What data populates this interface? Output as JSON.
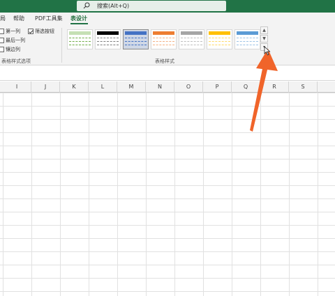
{
  "title_bar": {
    "search_placeholder": "搜索(Alt+Q)",
    "search_icon": "search-icon"
  },
  "tabs": [
    {
      "label": "局"
    },
    {
      "label": "帮助"
    },
    {
      "label": "PDF工具集"
    },
    {
      "label": "表设计",
      "active": true
    }
  ],
  "ribbon": {
    "options_group": {
      "items": [
        {
          "label": "第一列",
          "checked": false
        },
        {
          "label": "最后一列",
          "checked": false
        },
        {
          "label": "镶边列",
          "checked": false
        },
        {
          "label": "筛选按钮",
          "checked": true
        }
      ],
      "group_label": "表格样式选项"
    },
    "styles_group": {
      "group_label": "表格样式",
      "thumbnails": [
        {
          "name": "green-light",
          "accent": "#70ad47",
          "line": "#a9d18e"
        },
        {
          "name": "black-dark",
          "accent": "#000000",
          "line": "#7f7f7f"
        },
        {
          "name": "blue-medium-selected",
          "accent": "#4472c4",
          "line": "#4472c4"
        },
        {
          "name": "orange-medium",
          "accent": "#ed7d31",
          "line": "#f4b183"
        },
        {
          "name": "gray-medium",
          "accent": "#a5a5a5",
          "line": "#bfbfbf"
        },
        {
          "name": "gold-medium",
          "accent": "#ffc000",
          "line": "#ffd966"
        },
        {
          "name": "lightblue-medium",
          "accent": "#5b9bd5",
          "line": "#9dc3e6"
        }
      ]
    }
  },
  "columns": [
    "I",
    "J",
    "K",
    "L",
    "M",
    "N",
    "O",
    "P",
    "Q",
    "R",
    "S"
  ],
  "colors": {
    "brand_green": "#217346",
    "arrow": "#f0642a"
  }
}
